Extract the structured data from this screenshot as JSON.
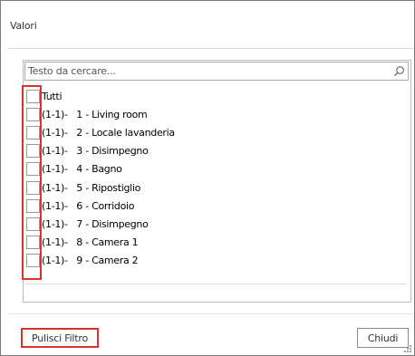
{
  "dialog": {
    "title": "Valori"
  },
  "search": {
    "placeholder": "Testo da cercare...",
    "value": "",
    "icon": "search-icon"
  },
  "list": {
    "items": [
      {
        "label": "Tutti",
        "checked": false
      },
      {
        "label": "(1-1)-   1 - Living room",
        "checked": false
      },
      {
        "label": "(1-1)-   2 - Locale lavanderia",
        "checked": false
      },
      {
        "label": "(1-1)-   3 - Disimpegno",
        "checked": false
      },
      {
        "label": "(1-1)-   4 - Bagno",
        "checked": false
      },
      {
        "label": "(1-1)-   5 - Ripostiglio",
        "checked": false
      },
      {
        "label": "(1-1)-   6 - Corridoio",
        "checked": false
      },
      {
        "label": "(1-1)-   7 - Disimpegno",
        "checked": false
      },
      {
        "label": "(1-1)-   8 - Camera 1",
        "checked": false
      },
      {
        "label": "(1-1)-   9 - Camera 2",
        "checked": false
      }
    ]
  },
  "footer": {
    "clear_label": "Pulisci Filtro",
    "close_label": "Chiudi"
  },
  "colors": {
    "highlight": "#d9342b",
    "border": "#bcbcbc",
    "text": "#333333"
  }
}
